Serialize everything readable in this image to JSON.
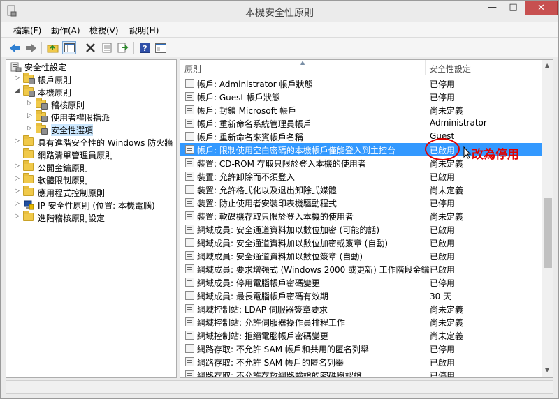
{
  "window": {
    "title": "本機安全性原則"
  },
  "menu": [
    {
      "label": "檔案(F)"
    },
    {
      "label": "動作(A)"
    },
    {
      "label": "檢視(V)"
    },
    {
      "label": "說明(H)"
    }
  ],
  "toolbar": {
    "buttons": [
      "back-arrow-icon",
      "forward-arrow-icon",
      "up-folder-icon",
      "show-hide-tree-icon",
      "delete-icon",
      "properties-icon",
      "export-list-icon",
      "help-icon",
      "console-view-icon"
    ]
  },
  "tree": {
    "root": {
      "label": "安全性設定"
    },
    "items": [
      {
        "label": "帳戶原則"
      },
      {
        "label": "本機原則"
      },
      {
        "label": "稽核原則"
      },
      {
        "label": "使用者權限指派"
      },
      {
        "label": "安全性選項"
      },
      {
        "label": "具有進階安全性的 Windows 防火牆"
      },
      {
        "label": "網路清單管理員原則"
      },
      {
        "label": "公開金鑰原則"
      },
      {
        "label": "軟體限制原則"
      },
      {
        "label": "應用程式控制原則"
      },
      {
        "label": "IP 安全性原則 (位置: 本機電腦)"
      },
      {
        "label": "進階稽核原則設定"
      }
    ]
  },
  "list": {
    "columns": {
      "policy": "原則",
      "setting": "安全性設定"
    },
    "rows": [
      {
        "policy": "帳戶: Administrator 帳戶狀態",
        "setting": "已停用"
      },
      {
        "policy": "帳戶: Guest 帳戶狀態",
        "setting": "已停用"
      },
      {
        "policy": "帳戶: 封鎖 Microsoft 帳戶",
        "setting": "尚未定義"
      },
      {
        "policy": "帳戶: 重新命名系統管理員帳戶",
        "setting": "Administrator"
      },
      {
        "policy": "帳戶: 重新命名來賓帳戶名稱",
        "setting": "Guest"
      },
      {
        "policy": "帳戶: 限制使用空白密碼的本機帳戶僅能登入到主控台",
        "setting": "已啟用"
      },
      {
        "policy": "裝置: CD-ROM 存取只限於登入本機的使用者",
        "setting": "尚未定義"
      },
      {
        "policy": "裝置: 允許卸除而不須登入",
        "setting": "已啟用"
      },
      {
        "policy": "裝置: 允許格式化以及退出卸除式媒體",
        "setting": "尚未定義"
      },
      {
        "policy": "裝置: 防止使用者安裝印表機驅動程式",
        "setting": "已停用"
      },
      {
        "policy": "裝置: 軟碟機存取只限於登入本機的使用者",
        "setting": "尚未定義"
      },
      {
        "policy": "網域成員: 安全通道資料加以數位加密 (可能的話)",
        "setting": "已啟用"
      },
      {
        "policy": "網域成員: 安全通道資料加以數位加密或簽章 (自動)",
        "setting": "已啟用"
      },
      {
        "policy": "網域成員: 安全通道資料加以數位簽章 (自動)",
        "setting": "已啟用"
      },
      {
        "policy": "網域成員: 要求增強式 (Windows 2000 或更新) 工作階段金鑰",
        "setting": "已啟用"
      },
      {
        "policy": "網域成員: 停用電腦帳戶密碼變更",
        "setting": "已停用"
      },
      {
        "policy": "網域成員: 最長電腦帳戶密碼有效期",
        "setting": "30 天"
      },
      {
        "policy": "網域控制站: LDAP 伺服器簽章要求",
        "setting": "尚未定義"
      },
      {
        "policy": "網域控制站: 允許伺服器操作員排程工作",
        "setting": "尚未定義"
      },
      {
        "policy": "網域控制站: 拒絕電腦帳戶密碼變更",
        "setting": "尚未定義"
      },
      {
        "policy": "網路存取: 不允許 SAM 帳戶和共用的匿名列舉",
        "setting": "已停用"
      },
      {
        "policy": "網路存取: 不允許 SAM 帳戶的匿名列舉",
        "setting": "已啟用"
      },
      {
        "policy": "網路存取: 不允許存放網路驗證的密碼與認證",
        "setting": "已停用"
      }
    ]
  },
  "annotation": {
    "text": "改為停用",
    "color": "#e00000"
  },
  "colors": {
    "selection": "#3399ff",
    "folder": "#f0c94a"
  }
}
